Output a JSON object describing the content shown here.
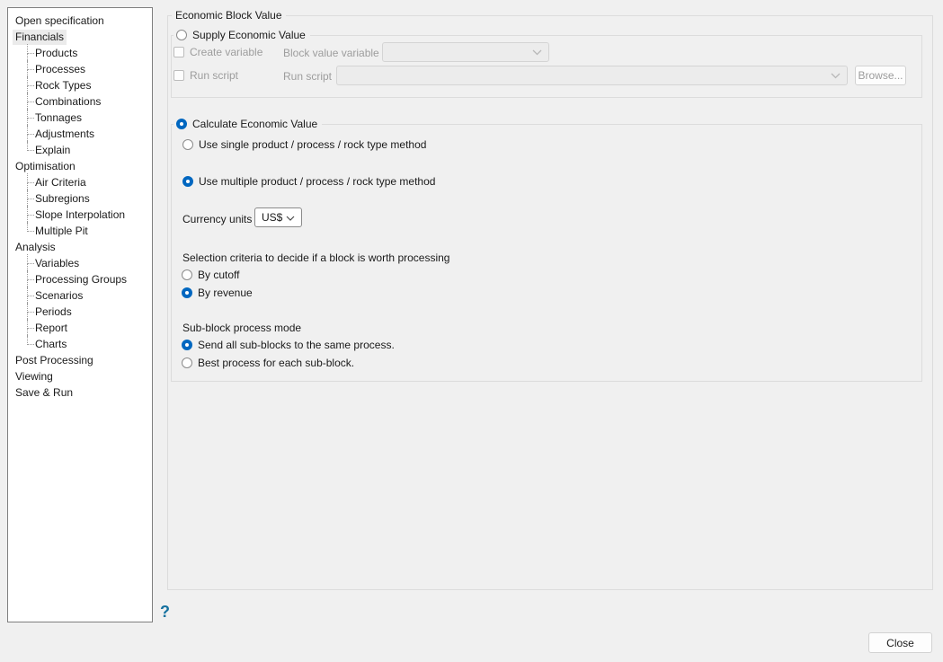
{
  "sidebar": {
    "selected_item": "Financials",
    "items": [
      {
        "label": "Open specification"
      },
      {
        "label": "Financials"
      },
      {
        "label": "Products"
      },
      {
        "label": "Processes"
      },
      {
        "label": "Rock Types"
      },
      {
        "label": "Combinations"
      },
      {
        "label": "Tonnages"
      },
      {
        "label": "Adjustments"
      },
      {
        "label": "Explain"
      },
      {
        "label": "Optimisation"
      },
      {
        "label": "Air Criteria"
      },
      {
        "label": "Subregions"
      },
      {
        "label": "Slope Interpolation"
      },
      {
        "label": "Multiple Pit"
      },
      {
        "label": "Analysis"
      },
      {
        "label": "Variables"
      },
      {
        "label": "Processing Groups"
      },
      {
        "label": "Scenarios"
      },
      {
        "label": "Periods"
      },
      {
        "label": "Report"
      },
      {
        "label": "Charts"
      },
      {
        "label": "Post Processing"
      },
      {
        "label": "Viewing"
      },
      {
        "label": "Save & Run"
      }
    ]
  },
  "panel": {
    "title": "Economic Block Value",
    "supply": {
      "radio_label": "Supply Economic Value",
      "radio_selected": false,
      "create_variable_label": "Create variable",
      "create_variable_checked": false,
      "block_value_variable_label": "Block value variable",
      "block_value_variable_value": "",
      "run_script_checkbox_label": "Run script",
      "run_script_checked": false,
      "run_script_field_label": "Run script",
      "run_script_value": "",
      "browse_button_label": "Browse..."
    },
    "calculate": {
      "radio_label": "Calculate Economic Value",
      "radio_selected": true,
      "single_method_label": "Use single product / process / rock type method",
      "single_method_selected": false,
      "multiple_method_label": "Use multiple product / process / rock type method",
      "multiple_method_selected": true,
      "currency_label": "Currency units",
      "currency_value": "US$",
      "selection_criteria_label": "Selection criteria to decide if a block is worth processing",
      "by_cutoff_label": "By cutoff",
      "by_cutoff_selected": false,
      "by_revenue_label": "By revenue",
      "by_revenue_selected": true,
      "sub_block_label": "Sub-block process mode",
      "send_all_label": "Send all sub-blocks to the same process.",
      "send_all_selected": true,
      "best_process_label": "Best process for each sub-block.",
      "best_process_selected": false
    },
    "help_icon": "?",
    "close_button_label": "Close"
  },
  "colors": {
    "window_bg": "#f0f0f0",
    "accent_radio": "#0067c0",
    "help_blue": "#15719f",
    "disabled_text": "#9d9d9d"
  }
}
